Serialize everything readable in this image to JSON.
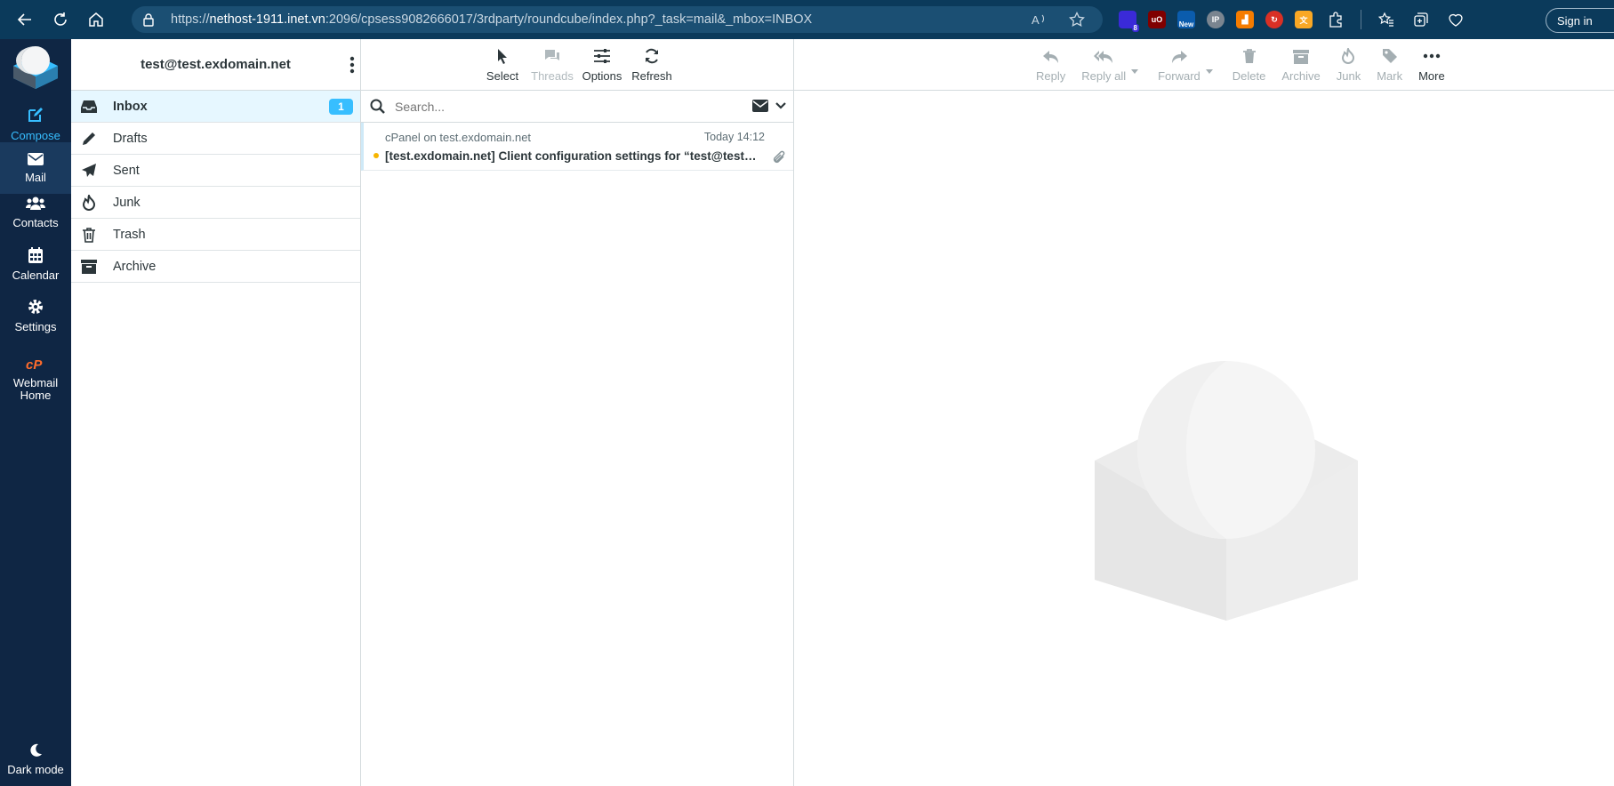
{
  "browser": {
    "url_prefix": "https://",
    "url_host": "nethost-1911.inet.vn",
    "url_rest": ":2096/cpsess9082666017/3rdparty/roundcube/index.php?_task=mail&_mbox=INBOX",
    "sign_in": "Sign in",
    "extensions": [
      {
        "icon": "extension-badge-icon",
        "badge": "8",
        "color": "#3a2ad8"
      },
      {
        "icon": "ublock-icon",
        "badge": "",
        "color": "#800000"
      },
      {
        "icon": "new-extension-icon",
        "badge": "New",
        "color": "#0b5cad"
      },
      {
        "icon": "ip-icon",
        "badge": "IP",
        "color": "#7a8590"
      },
      {
        "icon": "orange-chart-icon",
        "badge": "",
        "color": "#f57c00"
      },
      {
        "icon": "red-sync-icon",
        "badge": "",
        "color": "#d93025"
      },
      {
        "icon": "translate-icon",
        "badge": "",
        "color": "#f9a825"
      }
    ]
  },
  "nav": {
    "compose": "Compose",
    "mail": "Mail",
    "contacts": "Contacts",
    "calendar": "Calendar",
    "settings": "Settings",
    "webmail_home": "Webmail Home",
    "dark_mode": "Dark mode"
  },
  "folders": {
    "account": "test@test.exdomain.net",
    "items": [
      {
        "label": "Inbox",
        "icon": "inbox-icon",
        "count": "1"
      },
      {
        "label": "Drafts",
        "icon": "pencil-icon"
      },
      {
        "label": "Sent",
        "icon": "paper-plane-icon"
      },
      {
        "label": "Junk",
        "icon": "fire-icon"
      },
      {
        "label": "Trash",
        "icon": "trash-icon"
      },
      {
        "label": "Archive",
        "icon": "archive-icon"
      }
    ]
  },
  "list": {
    "toolbar": {
      "select": "Select",
      "threads": "Threads",
      "options": "Options",
      "refresh": "Refresh"
    },
    "search_placeholder": "Search...",
    "messages": [
      {
        "from": "cPanel on test.exdomain.net",
        "date": "Today 14:12",
        "subject": "[test.exdomain.net] Client configuration settings for “test@test.exdomain.net”.",
        "unread": true,
        "attachment": true
      }
    ]
  },
  "pane": {
    "toolbar": {
      "reply": "Reply",
      "reply_all": "Reply all",
      "forward": "Forward",
      "delete": "Delete",
      "archive": "Archive",
      "junk": "Junk",
      "mark": "Mark",
      "more": "More"
    }
  }
}
